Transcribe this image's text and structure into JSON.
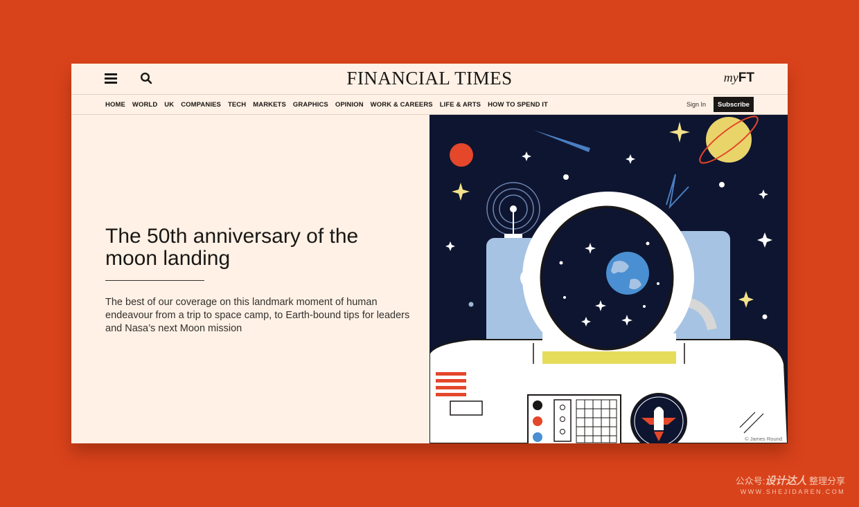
{
  "header": {
    "masthead": "FINANCIAL TIMES",
    "myft_prefix": "my",
    "myft_suffix": "FT"
  },
  "nav": {
    "items": [
      "HOME",
      "WORLD",
      "UK",
      "COMPANIES",
      "TECH",
      "MARKETS",
      "GRAPHICS",
      "OPINION",
      "WORK & CAREERS",
      "LIFE & ARTS",
      "HOW TO SPEND IT"
    ],
    "sign_in": "Sign In",
    "subscribe": "Subscribe"
  },
  "article": {
    "headline": "The 50th anniversary of the moon landing",
    "standfirst": "The best of our coverage on this landmark moment of human endeavour from a trip to space camp, to Earth-bound tips for leaders and Nasa’s next Moon mission",
    "image_credit": "© James Round"
  },
  "watermark": {
    "line1_prefix": "公众号:",
    "line1_brand": "设计达人",
    "line1_suffix": "整理分享",
    "line2": "WWW.SHEJIDAREN.COM"
  },
  "colors": {
    "background": "#d9431b",
    "paper": "#fff1e5",
    "ink": "#1a1715",
    "space": "#0e1530"
  },
  "icons": [
    "menu-icon",
    "search-icon"
  ]
}
